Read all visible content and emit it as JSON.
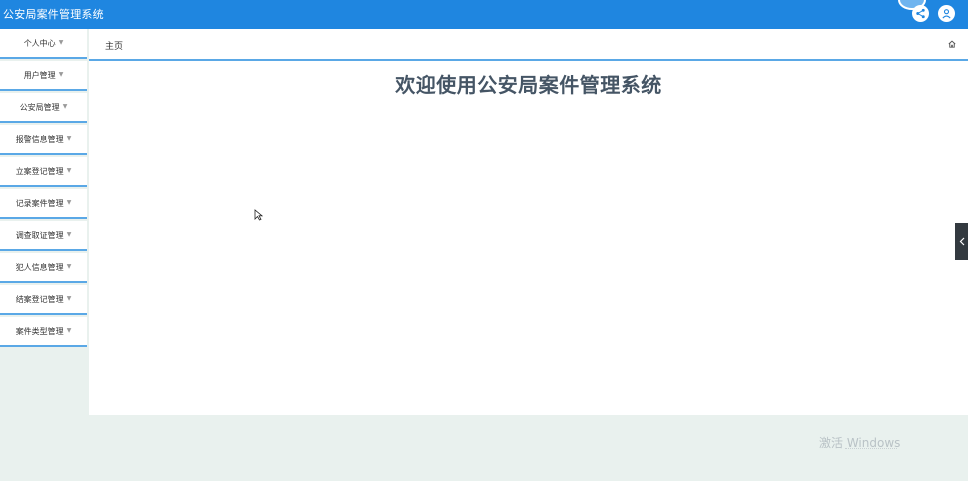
{
  "header": {
    "title": "公安局案件管理系统",
    "icons": [
      "share-icon",
      "user-icon"
    ],
    "colors": {
      "bar": "#1f86e0"
    }
  },
  "sidebar": {
    "items": [
      {
        "label": "个人中心"
      },
      {
        "label": "用户管理"
      },
      {
        "label": "公安局管理"
      },
      {
        "label": "报警信息管理"
      },
      {
        "label": "立案登记管理"
      },
      {
        "label": "记录案件管理"
      },
      {
        "label": "调查取证管理"
      },
      {
        "label": "犯人信息管理"
      },
      {
        "label": "结案登记管理"
      },
      {
        "label": "案件类型管理"
      }
    ]
  },
  "main": {
    "breadcrumb": "主页",
    "welcome": "欢迎使用公安局案件管理系统"
  },
  "watermark": {
    "text": "激活 Windows"
  }
}
